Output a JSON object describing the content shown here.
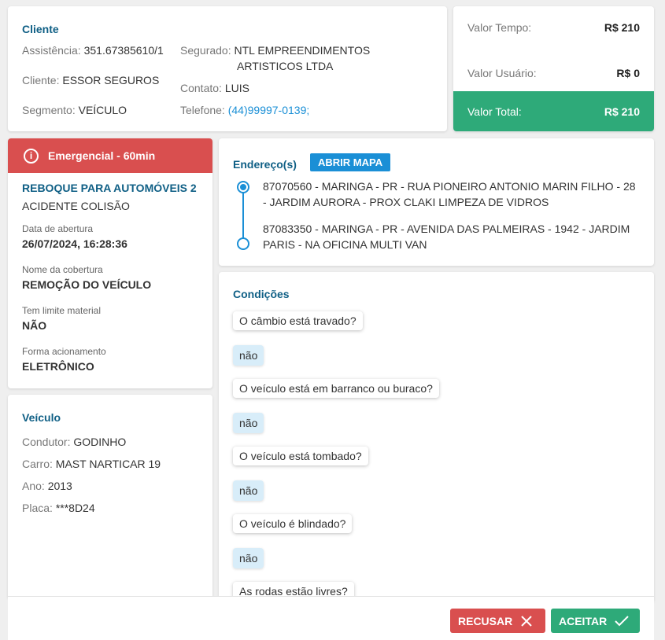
{
  "client": {
    "title": "Cliente",
    "assistencia_label": "Assistência:",
    "assistencia_value": "351.67385610/1",
    "cliente_label": "Cliente:",
    "cliente_value": "ESSOR SEGUROS",
    "segmento_label": "Segmento:",
    "segmento_value": "VEÍCULO",
    "segurado_label": "Segurado:",
    "segurado_value_line1": "NTL EMPREENDIMENTOS",
    "segurado_value_line2": "ARTISTICOS LTDA",
    "contato_label": "Contato:",
    "contato_value": "LUIS",
    "telefone_label": "Telefone:",
    "telefone_value": "(44)99997-0139;"
  },
  "values": {
    "tempo_label": "Valor Tempo:",
    "tempo_value": "R$ 210",
    "usuario_label": "Valor Usuário:",
    "usuario_value": "R$ 0",
    "total_label": "Valor Total:",
    "total_value": "R$ 210",
    "total_color": "#2eaa79"
  },
  "service": {
    "banner": "Emergencial - 60min",
    "banner_color": "#d94f4f",
    "service_name": "REBOQUE PARA AUTOMÓVEIS 2",
    "reason": "ACIDENTE COLISÃO",
    "opening_label": "Data de abertura",
    "opening_value": "26/07/2024, 16:28:36",
    "coverage_label": "Nome da cobertura",
    "coverage_value": "REMOÇÃO DO VEÍCULO",
    "limit_label": "Tem limite material",
    "limit_value": "NÃO",
    "trigger_label": "Forma acionamento",
    "trigger_value": "ELETRÔNICO"
  },
  "vehicle": {
    "title": "Veículo",
    "driver_label": "Condutor:",
    "driver_value": "GODINHO",
    "car_label": "Carro:",
    "car_value": "MAST NARTICAR 19",
    "year_label": "Ano:",
    "year_value": "2013",
    "plate_label": "Placa:",
    "plate_value": "***8D24"
  },
  "address": {
    "title": "Endereço(s)",
    "map_button": "ABRIR MAPA",
    "origin": "87070560 - MARINGA - PR - RUA PIONEIRO ANTONIO MARIN FILHO - 28 - JARDIM AURORA - PROX CLAKI LIMPEZA DE VIDROS",
    "destination": "87083350 - MARINGA - PR - AVENIDA DAS PALMEIRAS - 1942 - JARDIM PARIS - NA OFICINA MULTI VAN"
  },
  "conditions": {
    "title": "Condições",
    "items": [
      {
        "q": "O câmbio está travado?",
        "a": "não"
      },
      {
        "q": "O veículo está em barranco ou buraco?",
        "a": "não"
      },
      {
        "q": "O veículo está tombado?",
        "a": "não"
      },
      {
        "q": "O veículo é blindado?",
        "a": "não"
      },
      {
        "q": "As rodas estão livres?",
        "a": ""
      }
    ]
  },
  "footer": {
    "refuse_label": "RECUSAR",
    "accept_label": "ACEITAR",
    "refuse_color": "#d94f4f",
    "accept_color": "#2eaa79"
  }
}
